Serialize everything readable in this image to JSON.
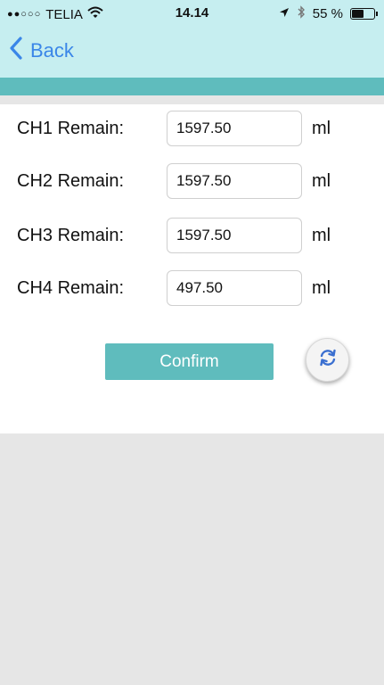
{
  "status_bar": {
    "signal_dots": "●●○○○",
    "carrier": "TELIA",
    "time": "14.14",
    "battery_text": "55 %",
    "battery_level": 0.55,
    "icons": [
      "wifi-icon",
      "location-arrow-icon",
      "bluetooth-icon",
      "battery-icon"
    ]
  },
  "nav": {
    "back_label": "Back",
    "back_icon": "chevron-left-icon"
  },
  "channels": [
    {
      "label": "CH1 Remain:",
      "value": "1597.50",
      "unit": "ml"
    },
    {
      "label": "CH2 Remain:",
      "value": "1597.50",
      "unit": "ml"
    },
    {
      "label": "CH3 Remain:",
      "value": "1597.50",
      "unit": "ml"
    },
    {
      "label": "CH4 Remain:",
      "value": "497.50",
      "unit": "ml"
    }
  ],
  "actions": {
    "confirm_label": "Confirm",
    "refresh_icon": "refresh-icon"
  },
  "colors": {
    "header_bg": "#c6eef0",
    "accent_teal": "#5fbcbd",
    "back_blue": "#3a86e8",
    "background_gray": "#e6e6e6"
  }
}
